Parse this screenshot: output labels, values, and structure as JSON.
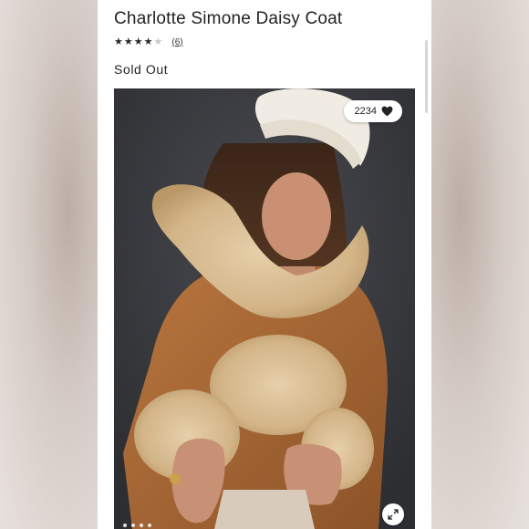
{
  "product": {
    "title": "Charlotte Simone Daisy Coat",
    "rating": 4,
    "rating_max": 5,
    "review_count": "(6)",
    "status": "Sold Out"
  },
  "gallery": {
    "like_count": "2234",
    "like_icon": "heart-icon",
    "expand_icon": "expand-icon",
    "image_count_indicator": 4
  },
  "colors": {
    "background": "#ffffff",
    "text": "#222222",
    "photo_backdrop": "#3a3b3f",
    "coat_suede": "#a86a3a",
    "fur": "#d9bf97"
  }
}
